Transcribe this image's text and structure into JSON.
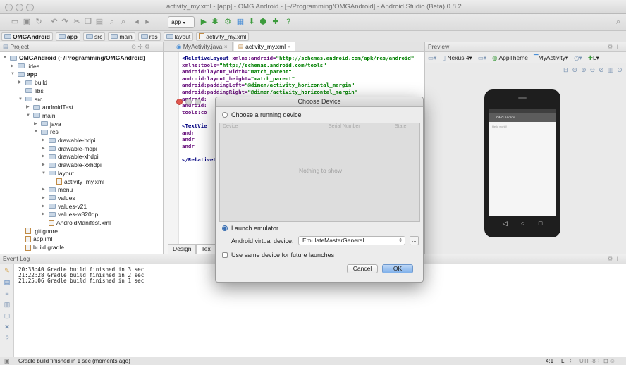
{
  "window": {
    "title": "activity_my.xml - [app] - OMG Android - [~/Programming/OMGAndroid] - Android Studio (Beta) 0.8.2"
  },
  "toolbar": {
    "run_config": "app",
    "icons": [
      "open-folder-icon",
      "save-icon",
      "sync-icon",
      "undo-icon",
      "redo-icon",
      "cut-icon",
      "copy-icon",
      "paste-icon",
      "find-icon",
      "replace-icon",
      "back-icon",
      "forward-icon",
      "run-icon",
      "debug-icon",
      "sdk-manager-icon",
      "help-icon"
    ]
  },
  "breadcrumb": [
    "OMGAndroid",
    "app",
    "src",
    "main",
    "res",
    "layout",
    "activity_my.xml"
  ],
  "project_panel": {
    "header": "Project",
    "tree": [
      {
        "label": "OMGAndroid (~/Programming/OMGAndroid)",
        "depth": 0,
        "expanded": true,
        "type": "module"
      },
      {
        "label": ".idea",
        "depth": 1,
        "expanded": false,
        "type": "folder"
      },
      {
        "label": "app",
        "depth": 1,
        "expanded": true,
        "type": "module"
      },
      {
        "label": "build",
        "depth": 2,
        "expanded": false,
        "type": "folder"
      },
      {
        "label": "libs",
        "depth": 2,
        "expanded": null,
        "type": "folder"
      },
      {
        "label": "src",
        "depth": 2,
        "expanded": true,
        "type": "folder"
      },
      {
        "label": "androidTest",
        "depth": 3,
        "expanded": false,
        "type": "folder"
      },
      {
        "label": "main",
        "depth": 3,
        "expanded": true,
        "type": "folder"
      },
      {
        "label": "java",
        "depth": 4,
        "expanded": false,
        "type": "folder"
      },
      {
        "label": "res",
        "depth": 4,
        "expanded": true,
        "type": "folder"
      },
      {
        "label": "drawable-hdpi",
        "depth": 5,
        "expanded": false,
        "type": "folder"
      },
      {
        "label": "drawable-mdpi",
        "depth": 5,
        "expanded": false,
        "type": "folder"
      },
      {
        "label": "drawable-xhdpi",
        "depth": 5,
        "expanded": false,
        "type": "folder"
      },
      {
        "label": "drawable-xxhdpi",
        "depth": 5,
        "expanded": false,
        "type": "folder"
      },
      {
        "label": "layout",
        "depth": 5,
        "expanded": true,
        "type": "folder"
      },
      {
        "label": "activity_my.xml",
        "depth": 6,
        "expanded": null,
        "type": "file"
      },
      {
        "label": "menu",
        "depth": 5,
        "expanded": false,
        "type": "folder"
      },
      {
        "label": "values",
        "depth": 5,
        "expanded": false,
        "type": "folder"
      },
      {
        "label": "values-v21",
        "depth": 5,
        "expanded": false,
        "type": "folder"
      },
      {
        "label": "values-w820dp",
        "depth": 5,
        "expanded": false,
        "type": "folder"
      },
      {
        "label": "AndroidManifest.xml",
        "depth": 5,
        "expanded": null,
        "type": "file"
      },
      {
        "label": ".gitignore",
        "depth": 2,
        "expanded": null,
        "type": "file"
      },
      {
        "label": "app.iml",
        "depth": 2,
        "expanded": null,
        "type": "file"
      },
      {
        "label": "build.gradle",
        "depth": 2,
        "expanded": null,
        "type": "file"
      }
    ]
  },
  "editor": {
    "tabs": [
      {
        "label": "MyActivity.java",
        "active": false
      },
      {
        "label": "activity_my.xml",
        "active": true
      }
    ],
    "code": [
      {
        "tag": "<RelativeLayout ",
        "attr": "xmlns:android=",
        "val": "\"http://schemas.android.com/apk/res/android\""
      },
      {
        "tag": "",
        "attr": "    xmlns:tools=",
        "val": "\"http://schemas.android.com/tools\""
      },
      {
        "tag": "",
        "attr": "    android:layout_width=",
        "val": "\"match_parent\""
      },
      {
        "tag": "",
        "attr": "    android:layout_height=",
        "val": "\"match_parent\""
      },
      {
        "tag": "",
        "attr": "    android:paddingLeft=",
        "val": "\"@dimen/activity_horizontal_margin\""
      },
      {
        "tag": "",
        "attr": "    android:paddingRight=",
        "val": "\"@dimen/activity_horizontal_margin\""
      },
      {
        "tag": "",
        "attr": "    android:",
        "val": ""
      },
      {
        "tag": "",
        "attr": "    android:",
        "val": ""
      },
      {
        "tag": "",
        "attr": "    tools:co",
        "val": ""
      },
      {
        "tag": "",
        "attr": "",
        "val": ""
      },
      {
        "tag": "    <TextVie",
        "attr": "",
        "val": ""
      },
      {
        "tag": "",
        "attr": "        andr",
        "val": ""
      },
      {
        "tag": "",
        "attr": "        andr",
        "val": ""
      },
      {
        "tag": "",
        "attr": "        andr",
        "val": ""
      },
      {
        "tag": "",
        "attr": "",
        "val": ""
      },
      {
        "tag": "</RelativeLa",
        "attr": "",
        "val": ""
      }
    ],
    "bottom_tabs": [
      "Design",
      "Tex"
    ]
  },
  "preview": {
    "header": "Preview",
    "device": "Nexus 4",
    "theme": "AppTheme",
    "activity": "MyActivity",
    "locale": "L",
    "app_title": "OMG Android",
    "hello_text": "Hello world!",
    "nav_glyphs": [
      "◁",
      "○",
      "□"
    ]
  },
  "event_log": {
    "header": "Event Log",
    "lines": [
      "20:33:40 Gradle build finished in 3 sec",
      "21:22:28 Gradle build finished in 2 sec",
      "21:25:06 Gradle build finished in 1 sec"
    ]
  },
  "status_bar": {
    "message": "Gradle build finished in 1 sec (moments ago)",
    "position": "4:1",
    "line_sep": "LF ÷",
    "encoding": "UTF-8 ÷"
  },
  "dialog": {
    "title": "Choose Device",
    "option_running": "Choose a running device",
    "table_headers": [
      "Device",
      "Serial Number",
      "State"
    ],
    "empty_text": "Nothing to show",
    "option_emulator": "Launch emulator",
    "avd_label": "Android virtual device:",
    "avd_value": "EmulateMasterGeneral",
    "dots": "...",
    "same_device_label": "Use same device for future launches",
    "cancel": "Cancel",
    "ok": "OK"
  },
  "colors": {
    "accent": "#3a6fb2",
    "ok_button": "#7fb0ea",
    "xml_value": "#008000",
    "xml_attr": "#660e7a"
  }
}
